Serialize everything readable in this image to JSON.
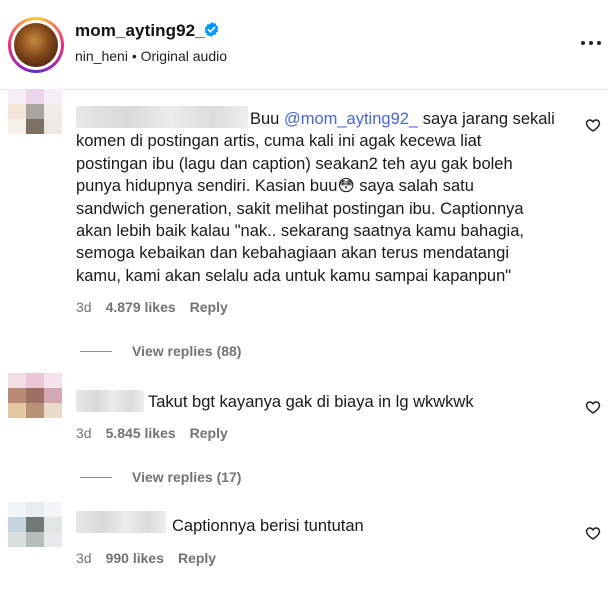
{
  "post": {
    "username": "mom_ayting92_",
    "audio_line": "nin_heni • Original audio",
    "icons": {
      "verified": "verified-badge-icon",
      "more": "more-options-icon"
    }
  },
  "comments": [
    {
      "username": "",
      "text_prefix": "Buu ",
      "mention": "@mom_ayting92_",
      "text_first_line_rest": " saya jarang sekali",
      "lines": [
        "komen di postingan artis, cuma kali ini agak kecewa liat",
        "postingan ibu (lagu dan caption) seakan2 teh ayu gak boleh",
        "punya hidupnya sendiri. Kasian buu😳  saya salah satu",
        "sandwich generation, sakit melihat postingan ibu. Captionnya",
        "akan lebih baik kalau \"nak.. sekarang saatnya kamu bahagia,",
        "semoga kebaikan dan kebahagiaan akan terus mendatangi",
        "kamu, kami akan selalu ada untuk kamu sampai kapanpun\""
      ],
      "time": "3d",
      "likes": "4.879 likes",
      "reply": "Reply",
      "view_replies": "View replies (88)"
    },
    {
      "username": "",
      "text": "Takut bgt kayanya gak di biaya in lg wkwkwk",
      "time": "3d",
      "likes": "5.845 likes",
      "reply": "Reply",
      "view_replies": "View replies (17)"
    },
    {
      "username": "",
      "text": "Captionnya berisi tuntutan",
      "time": "3d",
      "likes": "990 likes",
      "reply": "Reply"
    }
  ],
  "colors": {
    "mention": "#4a66d6",
    "meta": "#737373",
    "verified": "#0095f6"
  }
}
